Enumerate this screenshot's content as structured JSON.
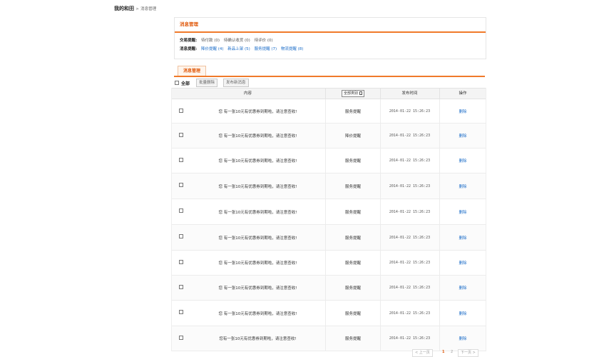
{
  "breadcrumb": {
    "home": "我的和田",
    "separator": ">",
    "current": "消息管理"
  },
  "panel": {
    "title": "消息管理",
    "trade": {
      "label": "交易提醒:",
      "items": [
        {
          "label": "待付款",
          "count": "(0)"
        },
        {
          "label": "待确认收货",
          "count": "(0)"
        },
        {
          "label": "待评价",
          "count": "(0)"
        }
      ]
    },
    "message": {
      "label": "消息提醒:",
      "items": [
        {
          "label": "降价提醒",
          "count": "(4)"
        },
        {
          "label": "新品上架",
          "count": "(5)"
        },
        {
          "label": "服务提醒",
          "count": "(7)"
        },
        {
          "label": "物流提醒",
          "count": "(8)"
        }
      ]
    }
  },
  "tab": {
    "label": "消息管理"
  },
  "toolbar": {
    "select_all": "全部",
    "batch_delete": "批量删除",
    "publish": "发布新消息"
  },
  "table": {
    "headers": {
      "content": "内容",
      "type_select": "全部类别",
      "time": "发布时间",
      "op": "操作"
    },
    "rows": [
      {
        "content": "您 有一张10元有优惠券到期啦，请注意查收!",
        "type": "服务提醒",
        "time": "2014-01-22 15:26:23",
        "op": "删除"
      },
      {
        "content": "您 有一张10元有优惠券到期啦，请注意查收!",
        "type": "降价提醒",
        "time": "2014-01-22 15:26:23",
        "op": "删除"
      },
      {
        "content": "您 有一张10元有优惠券到期啦，请注意查收!",
        "type": "服务提醒",
        "time": "2014-01-22 15:26:23",
        "op": "删除"
      },
      {
        "content": "您 有一张10元有优惠券到期啦，请注意查收!",
        "type": "服务提醒",
        "time": "2014-01-22 15:26:23",
        "op": "删除"
      },
      {
        "content": "您 有一张10元有优惠券到期啦，请注意查收!",
        "type": "服务提醒",
        "time": "2014-01-22 15:26:23",
        "op": "删除"
      },
      {
        "content": "您 有一张10元有优惠券到期啦，请注意查收!",
        "type": "服务提醒",
        "time": "2014-01-22 15:26:23",
        "op": "删除"
      },
      {
        "content": "您 有一张10元有优惠券到期啦，请注意查收!",
        "type": "服务提醒",
        "time": "2014-01-22 15:26:23",
        "op": "删除"
      },
      {
        "content": "您 有一张10元有优惠券到期啦，请注意查收!",
        "type": "服务提醒",
        "time": "2014-01-22 15:26:23",
        "op": "删除"
      },
      {
        "content": "您 有一张10元有优惠券到期啦，请注意查收!",
        "type": "服务提醒",
        "time": "2014-01-22 15:26:23",
        "op": "删除"
      },
      {
        "content": "您有一张10元有优惠券到期啦，请注意查收!",
        "type": "服务提醒",
        "time": "2014-01-22 15:26:23",
        "op": "删除"
      }
    ]
  },
  "pagination": {
    "prev": "< 上一页",
    "current": "1",
    "next_num": "2",
    "next": "下一页 >"
  },
  "colors": {
    "accent": "#f07a2a",
    "link": "#1a6cc8",
    "title": "#e05a0c"
  }
}
